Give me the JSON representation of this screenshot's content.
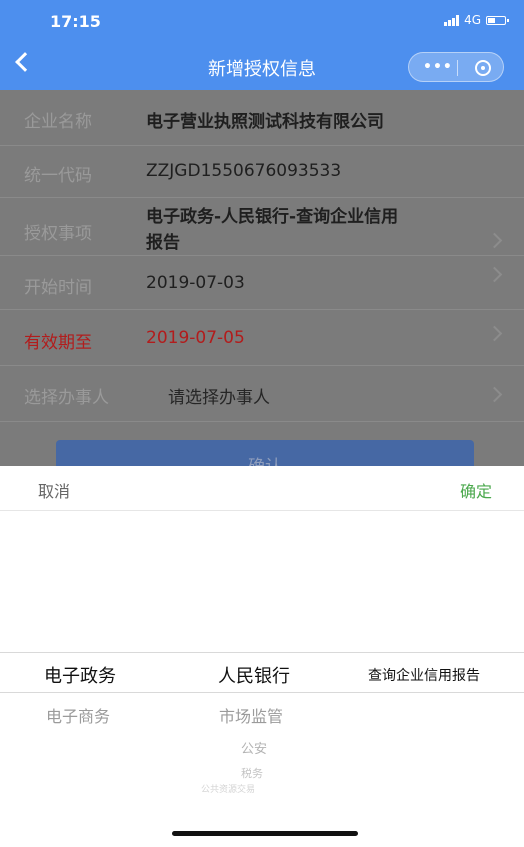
{
  "status_bar": {
    "time": "17:15",
    "network": "4G"
  },
  "nav": {
    "title": "新增授权信息"
  },
  "form": {
    "rows": [
      {
        "label": "企业名称",
        "value": "电子营业执照测试科技有限公司"
      },
      {
        "label": "统一代码",
        "value": "ZZJGD1550676093533"
      },
      {
        "label": "授权事项",
        "value_line1": "电子政务-人民银行-查询企业信用",
        "value_line2": "报告"
      },
      {
        "label": "开始时间",
        "value": "2019-07-03"
      },
      {
        "label": "有效期至",
        "value": "2019-07-05"
      },
      {
        "label": "选择办事人",
        "placeholder": "请选择办事人"
      }
    ],
    "confirm_label": "确认"
  },
  "picker": {
    "cancel_label": "取消",
    "ok_label": "确定",
    "columns": [
      {
        "selected": "电子政务",
        "options": [
          "电子商务"
        ]
      },
      {
        "selected": "人民银行",
        "options": [
          "市场监管",
          "公安",
          "税务",
          "公共资源交易"
        ]
      },
      {
        "selected": "查询企业信用报告",
        "options": []
      }
    ]
  },
  "colors": {
    "nav_bg": "#4d8fee",
    "ok_green": "#4aa84c",
    "warning_red": "#b21c1c"
  }
}
